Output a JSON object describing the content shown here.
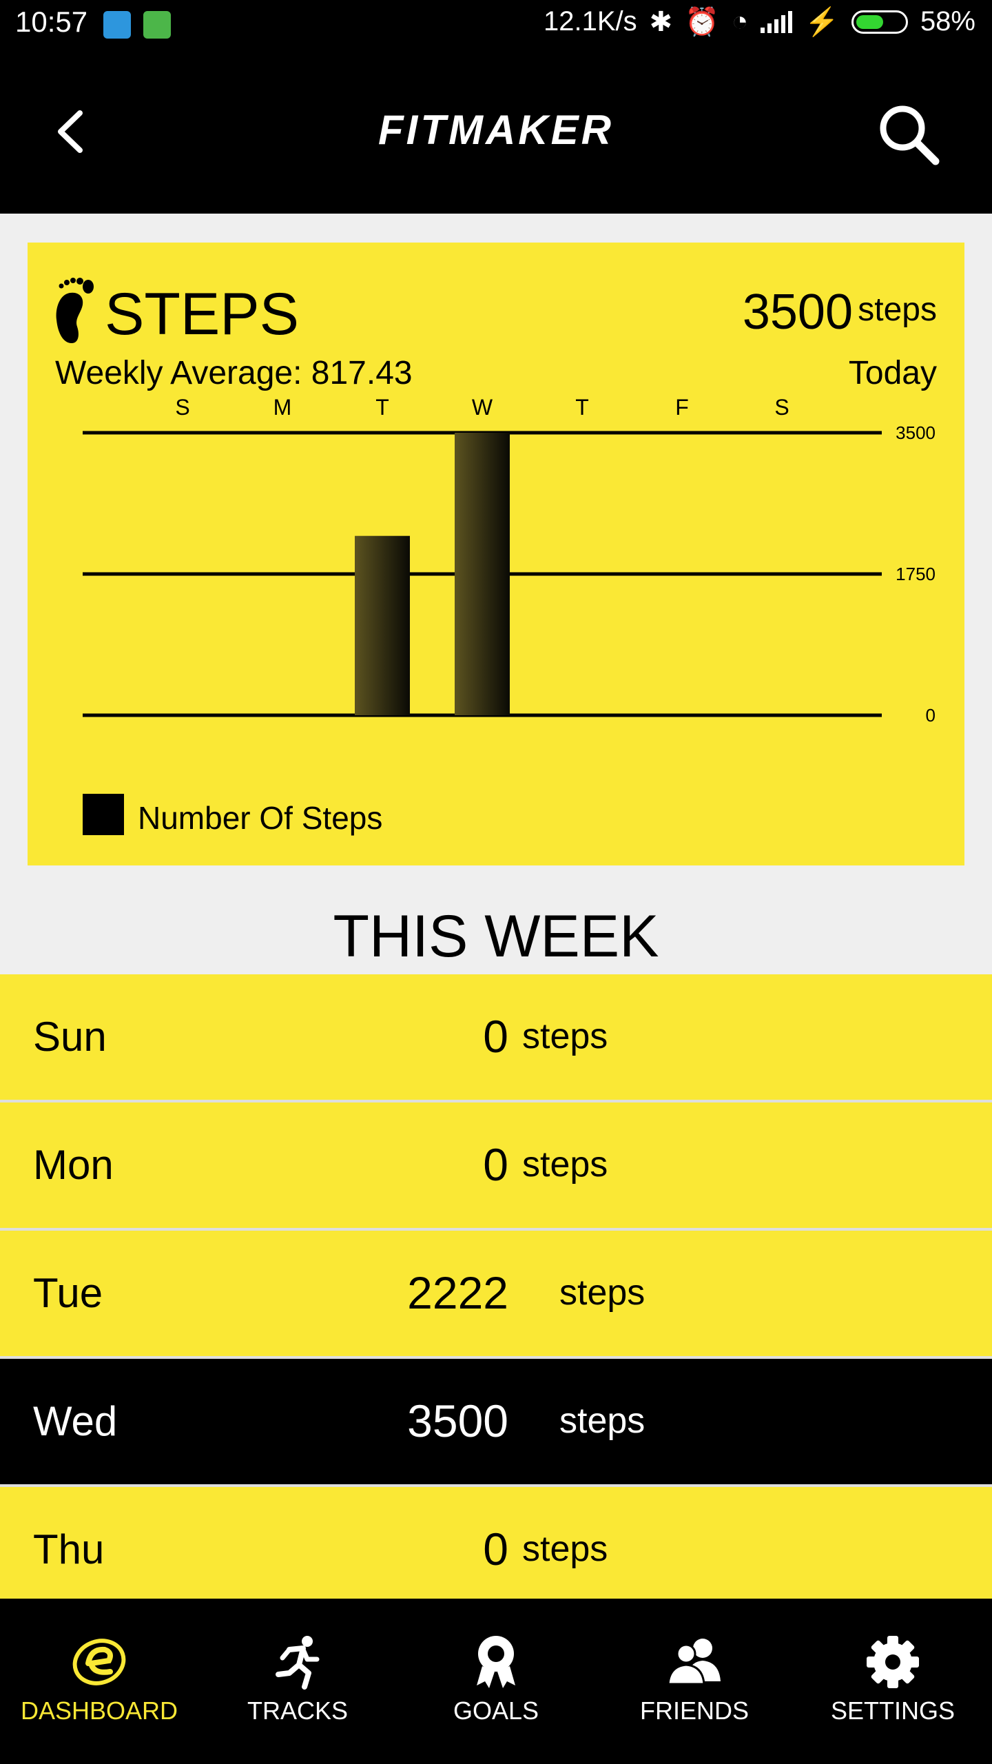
{
  "status_bar": {
    "time": "10:57",
    "speed": "12.1K/s",
    "battery": "58%",
    "battery_level": 0.58,
    "colors": {
      "app1": "#2d96dd",
      "app2": "#4cb649",
      "battery_fill": "#33d631"
    }
  },
  "header": {
    "logo": "FITMAKER"
  },
  "steps_card": {
    "title": "STEPS",
    "today_value": "3500",
    "today_unit": "steps",
    "weekly_average": "Weekly Average: 817.43",
    "today_label": "Today",
    "legend": "Number Of Steps"
  },
  "chart_data": {
    "type": "bar",
    "categories": [
      "S",
      "M",
      "T",
      "W",
      "T",
      "F",
      "S"
    ],
    "series": [
      {
        "name": "Number Of Steps",
        "values": [
          0,
          0,
          2222,
          3500,
          0,
          0,
          0
        ]
      }
    ],
    "y_ticks": [
      "3500",
      "1750",
      "0"
    ],
    "ylim": [
      0,
      3500
    ],
    "legend": "bottom-left",
    "grid": true
  },
  "week": {
    "title": "THIS WEEK",
    "rows": [
      {
        "day": "Sun",
        "value": "0",
        "unit": "steps"
      },
      {
        "day": "Mon",
        "value": "0",
        "unit": "steps"
      },
      {
        "day": "Tue",
        "value": "2222",
        "unit": "steps"
      },
      {
        "day": "Wed",
        "value": "3500",
        "unit": "steps"
      },
      {
        "day": "Thu",
        "value": "0",
        "unit": "steps"
      }
    ]
  },
  "nav": [
    {
      "label": "DASHBOARD",
      "icon": "dashboard-icon"
    },
    {
      "label": "TRACKS",
      "icon": "runner-icon"
    },
    {
      "label": "GOALS",
      "icon": "ribbon-icon"
    },
    {
      "label": "FRIENDS",
      "icon": "friends-icon"
    },
    {
      "label": "SETTINGS",
      "icon": "gear-icon"
    }
  ],
  "colors": {
    "accent": "#fae835",
    "dark": "#000000"
  }
}
